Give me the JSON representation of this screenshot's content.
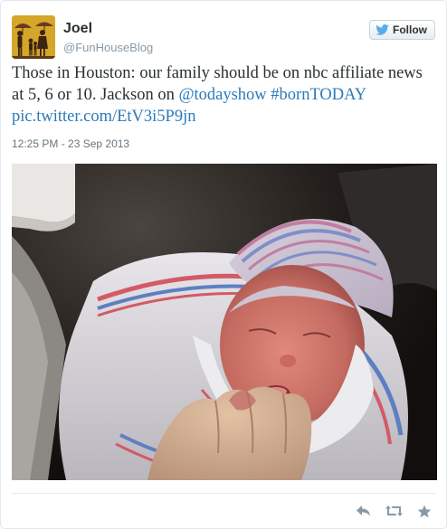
{
  "author": {
    "name": "Joel",
    "handle": "@FunHouseBlog"
  },
  "follow_button": {
    "label": "Follow",
    "icon": "twitter-bird-icon"
  },
  "tweet": {
    "text_before_links": "Those in Houston: our family should be on nbc affiliate news at 5, 6 or 10. Jackson on",
    "mention": "@todayshow",
    "hashtag": "#bornTODAY",
    "pic_link": "pic.twitter.com/EtV3i5P9jn",
    "timestamp": "12:25 PM - 23 Sep 2013"
  },
  "actions": [
    {
      "name": "reply",
      "icon": "reply-arrow-icon"
    },
    {
      "name": "retweet",
      "icon": "retweet-icon"
    },
    {
      "name": "favorite",
      "icon": "star-icon"
    }
  ],
  "colors": {
    "link": "#2b7bb9",
    "twitter_blue": "#55acee",
    "text": "#292f33",
    "muted": "#8899a6",
    "avatar_bg": "#b8941c"
  }
}
